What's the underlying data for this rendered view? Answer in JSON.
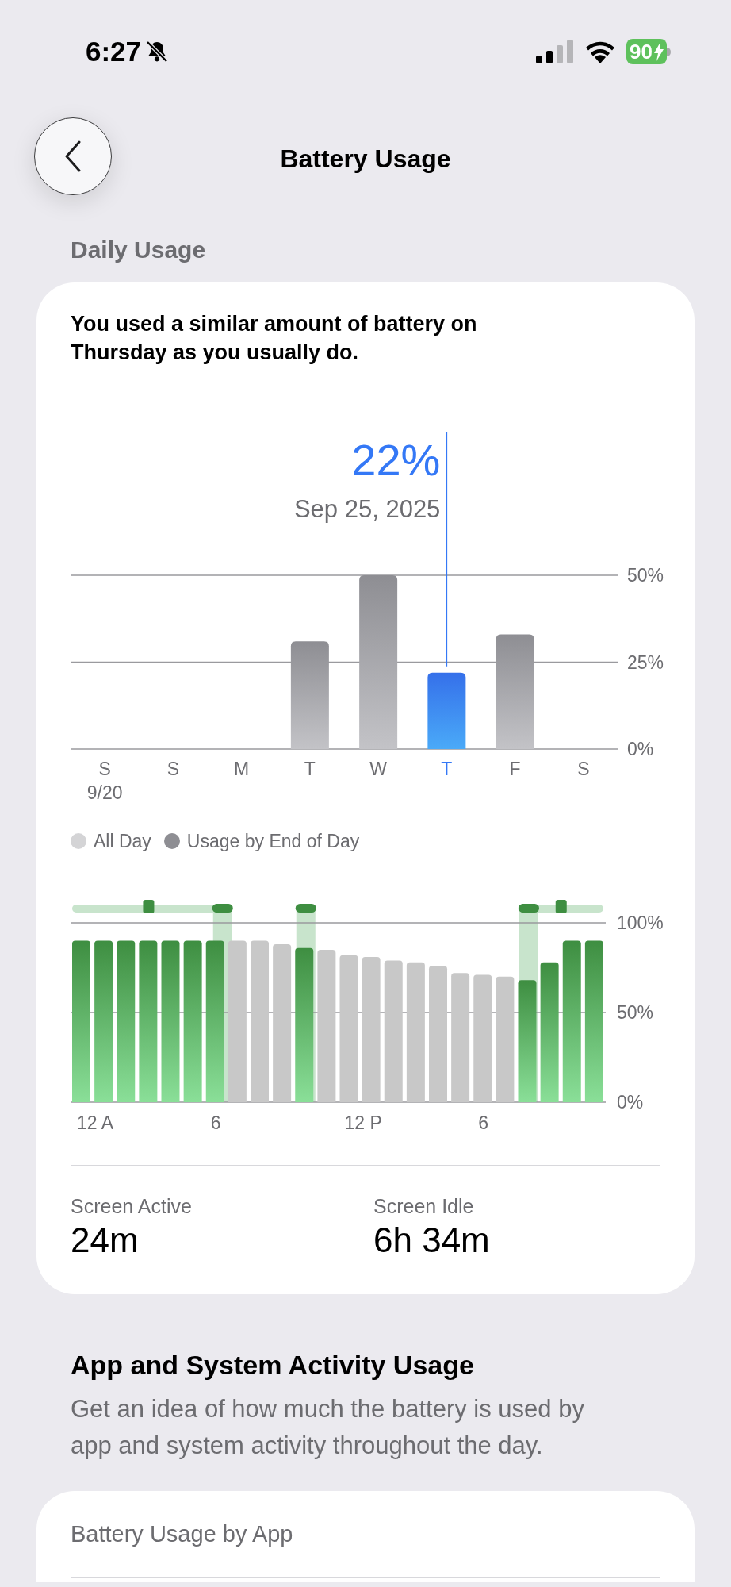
{
  "status_bar": {
    "time": "6:27",
    "battery_percent": "90"
  },
  "nav": {
    "title": "Battery Usage"
  },
  "section_title": "Daily Usage",
  "daily_card": {
    "summary": "You used a similar amount of battery on Thursday as you usually do.",
    "first_date_label": "9/20",
    "chart_data": {
      "type": "bar",
      "categories": [
        "S",
        "S",
        "M",
        "T",
        "W",
        "T",
        "F",
        "S"
      ],
      "values": [
        null,
        null,
        null,
        31,
        50,
        22,
        33,
        null
      ],
      "ylim": [
        0,
        50
      ],
      "yticks": [
        {
          "value": 50,
          "label": "50%"
        },
        {
          "value": 25,
          "label": "25%"
        },
        {
          "value": 0,
          "label": "0%"
        }
      ]
    },
    "days": [
      {
        "selected": false
      },
      {
        "selected": false
      },
      {
        "selected": false
      },
      {
        "selected": false
      },
      {
        "selected": false
      },
      {
        "selected": true
      },
      {
        "selected": false
      },
      {
        "selected": false
      }
    ],
    "selected_value": "22%",
    "selected_date": "Sep 25, 2025",
    "legend": [
      {
        "label": "All Day",
        "color": "#d4d4d6"
      },
      {
        "label": "Usage by End of Day",
        "color": "#8e8e93"
      }
    ],
    "level_chart": {
      "hour_labels": [
        "12 A",
        "6",
        "12 P",
        "6"
      ],
      "chart_data": {
        "type": "bar",
        "series": [
          {
            "color": "#3e8e41",
            "values": [
              90,
              90,
              90,
              90,
              90,
              90,
              90,
              null,
              null,
              null,
              86,
              null,
              null,
              null,
              null,
              null,
              null,
              null,
              null,
              null,
              68,
              78,
              90,
              90
            ]
          },
          {
            "color": "#c8c8c8",
            "values": [
              null,
              null,
              null,
              null,
              null,
              null,
              null,
              90,
              90,
              88,
              null,
              85,
              82,
              81,
              79,
              78,
              76,
              72,
              71,
              70,
              null,
              null,
              null,
              null
            ]
          }
        ],
        "ylim": [
          0,
          100
        ],
        "yticks": [
          {
            "value": 100,
            "label": "100%"
          },
          {
            "value": 50,
            "label": "50%"
          },
          {
            "value": 0,
            "label": "0%"
          }
        ]
      }
    },
    "stats": [
      {
        "label": "Screen Active",
        "value": "24m"
      },
      {
        "label": "Screen Idle",
        "value": "6h 34m"
      }
    ]
  },
  "activity_section": {
    "title": "App and System Activity Usage",
    "description": "Get an idea of how much the battery is used by app and system activity throughout the day."
  },
  "app_card": {
    "title": "Battery Usage by App"
  }
}
